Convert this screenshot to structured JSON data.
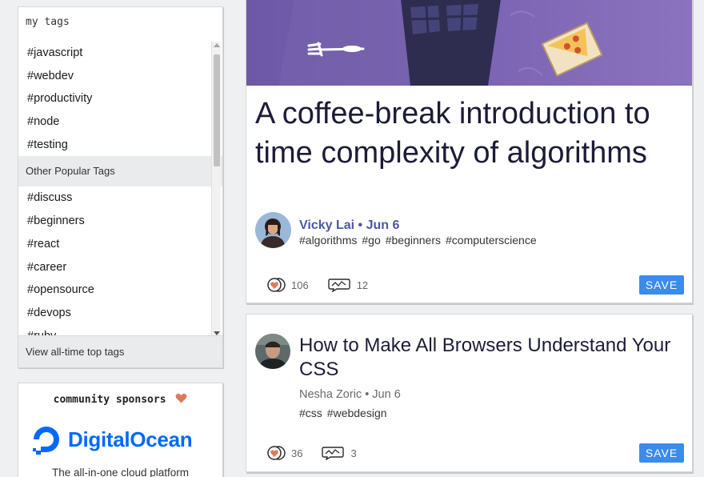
{
  "sidebar": {
    "tags_title": "my tags",
    "my_tags": [
      "#javascript",
      "#webdev",
      "#productivity",
      "#node",
      "#testing"
    ],
    "popular_section_label": "Other Popular Tags",
    "popular_tags": [
      "#discuss",
      "#beginners",
      "#react",
      "#career",
      "#opensource",
      "#devops",
      "#ruby"
    ],
    "footer_link": "View all-time top tags"
  },
  "sponsors": {
    "title": "community sponsors",
    "sponsor_name": "DigitalOcean",
    "tagline": "The all-in-one cloud platform",
    "brand_color": "#0069ff",
    "heart_color": "#e27d60"
  },
  "articles": [
    {
      "title": "A coffee-break introduction to time complexity of algorithms",
      "author": "Vicky Lai",
      "date": "• Jun 6",
      "tags": [
        "#algorithms",
        "#go",
        "#beginners",
        "#computerscience"
      ],
      "reactions": "106",
      "comments": "12",
      "save_label": "SAVE"
    },
    {
      "title": "How to Make All Browsers Understand Your CSS",
      "author": "Nesha Zoric",
      "date": "• Jun 6",
      "tags": [
        "#css",
        "#webdesign"
      ],
      "reactions": "36",
      "comments": "3",
      "save_label": "SAVE"
    }
  ],
  "colors": {
    "page_bg": "#eef0f1",
    "save_button": "#3b8beb",
    "author_accent": "#4e57a4",
    "headline": "#1c1c38",
    "cover_bg": "#6e5aa8"
  }
}
